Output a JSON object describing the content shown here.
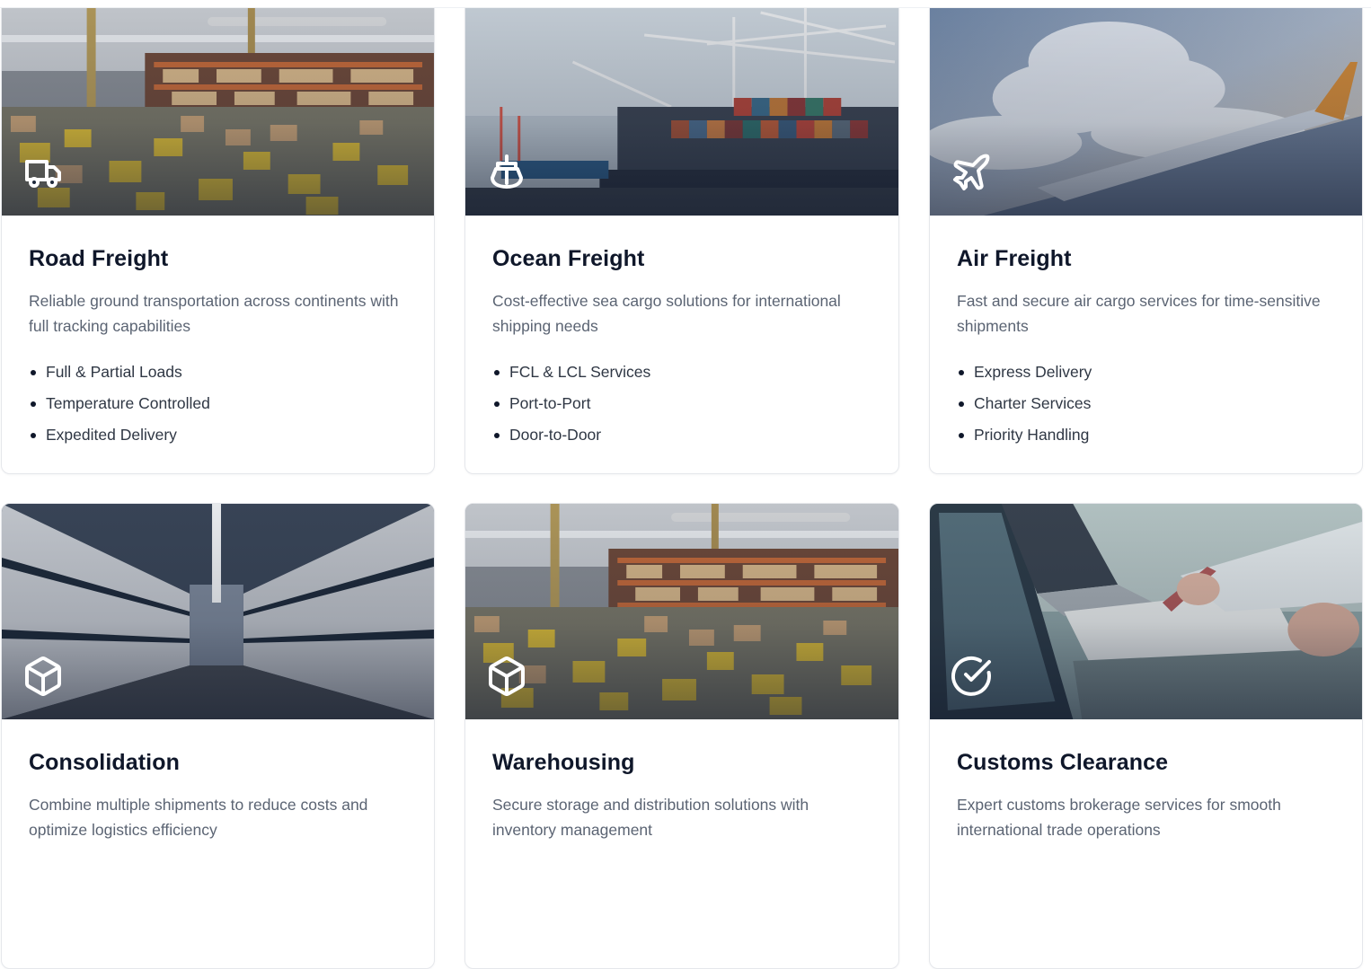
{
  "services": [
    {
      "title": "Road Freight",
      "description": "Reliable ground transportation across continents with full tracking capabilities",
      "icon": "truck-icon",
      "image": "warehouse-floor-photo",
      "features": [
        "Full & Partial Loads",
        "Temperature Controlled",
        "Expedited Delivery"
      ]
    },
    {
      "title": "Ocean Freight",
      "description": "Cost-effective sea cargo solutions for international shipping needs",
      "icon": "ship-icon",
      "image": "container-ship-port-photo",
      "features": [
        "FCL & LCL Services",
        "Port-to-Port",
        "Door-to-Door"
      ]
    },
    {
      "title": "Air Freight",
      "description": "Fast and secure air cargo services for time-sensitive shipments",
      "icon": "plane-icon",
      "image": "airplane-wing-sky-photo",
      "features": [
        "Express Delivery",
        "Charter Services",
        "Priority Handling"
      ]
    },
    {
      "title": "Consolidation",
      "description": "Combine multiple shipments to reduce costs and optimize logistics efficiency",
      "icon": "package-icon",
      "image": "warehouse-aisle-photo"
    },
    {
      "title": "Warehousing",
      "description": "Secure storage and distribution solutions with inventory management",
      "icon": "package-icon",
      "image": "warehouse-floor-photo"
    },
    {
      "title": "Customs Clearance",
      "description": "Expert customs brokerage services for smooth international trade operations",
      "icon": "check-circle-icon",
      "image": "laptop-paperwork-photo"
    }
  ],
  "colors": {
    "text_primary": "#0f172a",
    "text_secondary": "#5b6473",
    "card_border": "#e5e7eb",
    "icon": "#ffffff"
  }
}
